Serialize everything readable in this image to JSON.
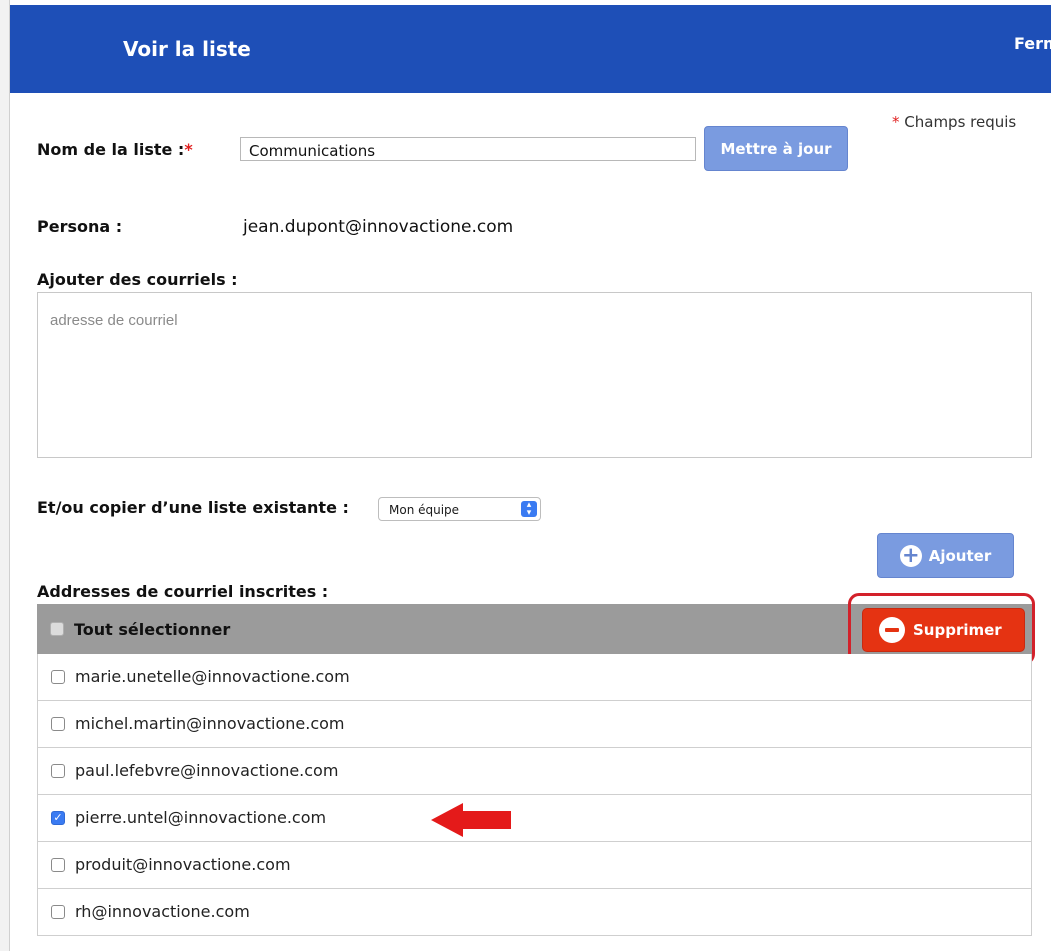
{
  "header": {
    "title": "Voir la liste",
    "close_label": "Fermer"
  },
  "required_note": {
    "star": "*",
    "text": " Champs requis"
  },
  "list_name": {
    "label": "Nom de la liste :",
    "star": "*",
    "value": "Communications",
    "update_button": "Mettre à jour"
  },
  "persona": {
    "label": "Persona :",
    "value": "jean.dupont@innovactione.com"
  },
  "add_emails": {
    "label": "Ajouter des courriels :",
    "placeholder": "adresse de courriel"
  },
  "copy_list": {
    "label": "Et/ou copier d’une liste existante :",
    "selected": "Mon équipe"
  },
  "add_button": {
    "label": "Ajouter",
    "icon": "plus-circle-icon"
  },
  "subscribed": {
    "label": "Addresses de courriel inscrites :",
    "select_all": "Tout sélectionner",
    "delete_button": "Supprimer",
    "rows": [
      {
        "email": "marie.unetelle@innovactione.com",
        "checked": false
      },
      {
        "email": "michel.martin@innovactione.com",
        "checked": false
      },
      {
        "email": "paul.lefebvre@innovactione.com",
        "checked": false
      },
      {
        "email": "pierre.untel@innovactione.com",
        "checked": true
      },
      {
        "email": "produit@innovactione.com",
        "checked": false
      },
      {
        "email": "rh@innovactione.com",
        "checked": false
      }
    ]
  },
  "colors": {
    "header": "#1e4fb7",
    "button_blue": "#7a9be0",
    "delete": "#e53312",
    "highlight": "#d3212a"
  }
}
